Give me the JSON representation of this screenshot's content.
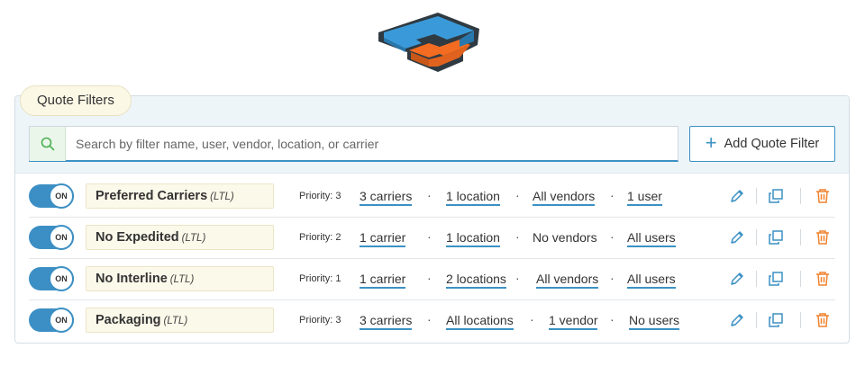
{
  "panel": {
    "title": "Quote Filters",
    "search": {
      "placeholder": "Search by filter name, user, vendor, location, or carrier",
      "value": ""
    },
    "add_button_label": "Add Quote Filter"
  },
  "colors": {
    "accent_blue": "#3c91c3",
    "toggle_on": "#3c8fc4",
    "edit_icon": "#3c91c3",
    "copy_icon": "#3c91c3",
    "delete_icon": "#f0822e",
    "logo_blue": "#3a9ad9",
    "logo_orange": "#f36c21"
  },
  "icons": {
    "search": "search-icon",
    "add": "plus-icon",
    "edit": "pencil-icon",
    "copy": "copy-icon",
    "delete": "trash-icon"
  },
  "filters": [
    {
      "toggle": "ON",
      "name": "Preferred Carriers",
      "type": "(LTL)",
      "priority": "Priority: 3",
      "carriers": "3 carriers",
      "locations": "1 location",
      "vendors": "All vendors",
      "users": "1 user"
    },
    {
      "toggle": "ON",
      "name": "No Expedited",
      "type": "(LTL)",
      "priority": "Priority: 2",
      "carriers": "1 carrier",
      "locations": "1 location",
      "vendors": "No vendors",
      "users": "All users"
    },
    {
      "toggle": "ON",
      "name": "No Interline",
      "type": "(LTL)",
      "priority": "Priority: 1",
      "carriers": "1 carrier",
      "locations": "2 locations",
      "vendors": "All vendors",
      "users": "All users"
    },
    {
      "toggle": "ON",
      "name": "Packaging",
      "type": "(LTL)",
      "priority": "Priority: 3",
      "carriers": "3 carriers",
      "locations": "All locations",
      "vendors": "1 vendor",
      "users": "No users"
    }
  ],
  "separator": "·"
}
